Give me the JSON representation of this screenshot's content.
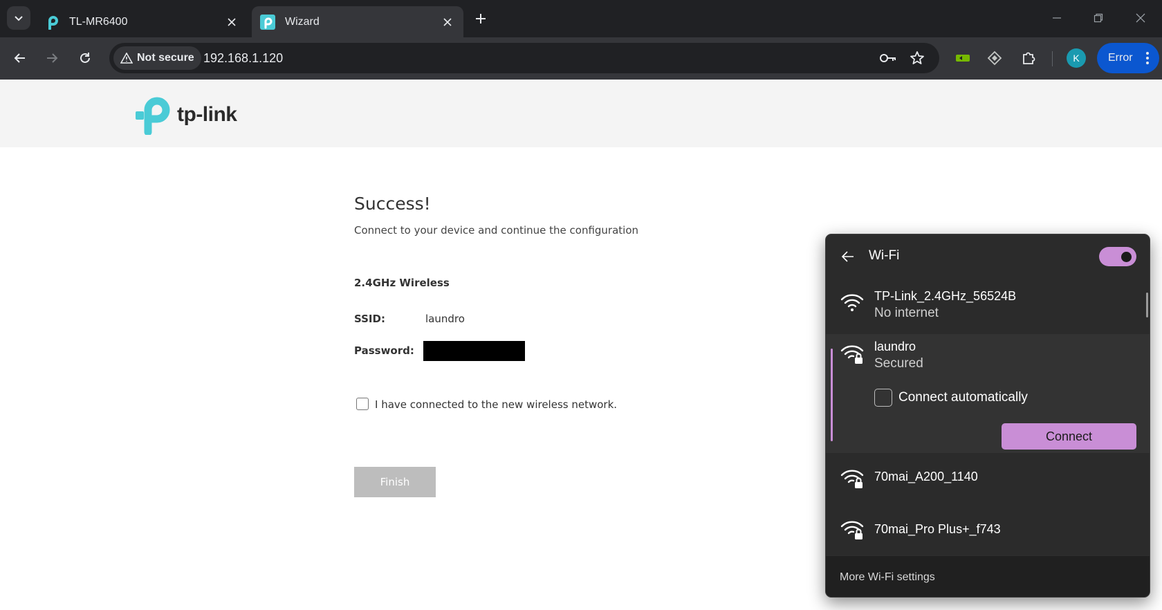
{
  "browser": {
    "tabs": [
      {
        "title": "TL-MR6400",
        "active": false
      },
      {
        "title": "Wizard",
        "active": true
      }
    ],
    "security_chip": "Not secure",
    "url": "192.168.1.120",
    "profile_initial": "K",
    "error_label": "Error"
  },
  "page": {
    "brand": "tp-link",
    "title": "Success!",
    "subtitle": "Connect to your device and continue the configuration",
    "section": "2.4GHz Wireless",
    "ssid_label": "SSID:",
    "ssid_value": "laundro",
    "password_label": "Password:",
    "confirm_label": "I have connected to the new wireless network.",
    "finish_label": "Finish"
  },
  "wifi": {
    "title": "Wi-Fi",
    "enabled": true,
    "networks": [
      {
        "name": "TP-Link_2.4GHz_56524B",
        "status": "No internet",
        "secured": false
      },
      {
        "name": "laundro",
        "status": "Secured",
        "secured": true
      },
      {
        "name": "70mai_A200_1140",
        "status": "",
        "secured": true
      },
      {
        "name": "70mai_Pro Plus+_f743",
        "status": "",
        "secured": true
      }
    ],
    "auto_connect_label": "Connect automatically",
    "connect_label": "Connect",
    "more_settings": "More Wi-Fi settings",
    "accent": "#c98ed6"
  }
}
